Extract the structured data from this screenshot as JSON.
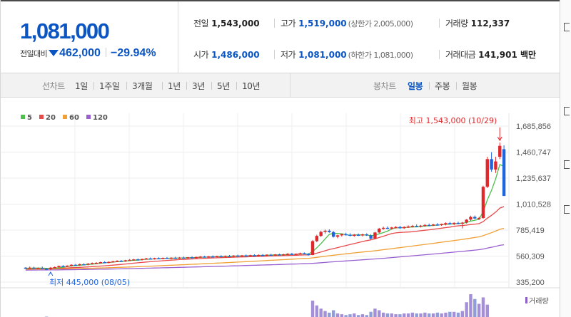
{
  "quote": {
    "price": "1,081,000",
    "change_label": "전일대비",
    "change_amount": "462,000",
    "change_rate": "−29.94%",
    "row1": [
      {
        "label": "전일",
        "value": "1,543,000",
        "blue": false,
        "note": ""
      },
      {
        "label": "고가",
        "value": "1,519,000",
        "blue": true,
        "note": "(상한가 2,005,000)"
      },
      {
        "label": "거래량",
        "value": "112,337",
        "blue": false,
        "note": ""
      }
    ],
    "row2": [
      {
        "label": "시가",
        "value": "1,486,000",
        "blue": true,
        "note": ""
      },
      {
        "label": "저가",
        "value": "1,081,000",
        "blue": true,
        "note": "(하한가 1,081,000)"
      },
      {
        "label": "거래대금",
        "value": "141,901 백만",
        "blue": false,
        "note": ""
      }
    ]
  },
  "toolbar": {
    "line_chart_label": "선차트",
    "periods": [
      "1일",
      "1주일",
      "3개월",
      "1년",
      "3년",
      "5년",
      "10년"
    ],
    "candle_chart_label": "봉차트",
    "candle_periods": [
      "일봉",
      "주봉",
      "월봉"
    ],
    "active_candle_period": "일봉"
  },
  "chart_data": {
    "type": "candlestick",
    "title": "",
    "legend": [
      {
        "name": "5",
        "color": "#4cbf4c"
      },
      {
        "name": "20",
        "color": "#e84a4a"
      },
      {
        "name": "60",
        "color": "#f0a035"
      },
      {
        "name": "120",
        "color": "#9a5fd0"
      }
    ],
    "y_axis": {
      "ticks": [
        "1,685,856",
        "1,460,747",
        "1,235,637",
        "1,010,528",
        "785,419",
        "560,309",
        "335,200"
      ],
      "ylim": [
        335200,
        1685856
      ],
      "position": "right"
    },
    "grid": true,
    "up_color": "#e0272b",
    "down_color": "#1f64dd",
    "annotations": {
      "high": {
        "text": "최고 1,543,000 (10/29)",
        "value": 1543000,
        "date": "10/29"
      },
      "low": {
        "text": "최저 445,000 (08/05)",
        "value": 445000,
        "date": "08/05"
      }
    },
    "volume_label": "거래량",
    "candles": [
      [
        460000,
        465000,
        450000,
        455000
      ],
      [
        455000,
        470000,
        448000,
        460000
      ],
      [
        460000,
        468000,
        452000,
        455000
      ],
      [
        455000,
        462000,
        450000,
        458000
      ],
      [
        458000,
        470000,
        452000,
        452000
      ],
      [
        450000,
        458000,
        445000,
        448000
      ],
      [
        448000,
        465000,
        440000,
        460000
      ],
      [
        460000,
        470000,
        455000,
        465000
      ],
      [
        465000,
        478000,
        460000,
        475000
      ],
      [
        475000,
        482000,
        468000,
        472000
      ],
      [
        472000,
        480000,
        465000,
        478000
      ],
      [
        478000,
        490000,
        470000,
        485000
      ],
      [
        485000,
        492000,
        478000,
        482000
      ],
      [
        482000,
        495000,
        476000,
        490000
      ],
      [
        490000,
        498000,
        484000,
        486000
      ],
      [
        486000,
        500000,
        480000,
        495000
      ],
      [
        495000,
        505000,
        488000,
        500000
      ],
      [
        500000,
        508000,
        494000,
        502000
      ],
      [
        502000,
        512000,
        496000,
        508000
      ],
      [
        508000,
        516000,
        500000,
        504000
      ],
      [
        504000,
        514000,
        498000,
        510000
      ],
      [
        510000,
        520000,
        505000,
        515000
      ],
      [
        515000,
        524000,
        508000,
        520000
      ],
      [
        520000,
        526000,
        512000,
        516000
      ],
      [
        516000,
        528000,
        510000,
        524000
      ],
      [
        524000,
        534000,
        518000,
        528000
      ],
      [
        528000,
        536000,
        520000,
        532000
      ],
      [
        532000,
        540000,
        525000,
        527000
      ],
      [
        527000,
        538000,
        522000,
        535000
      ],
      [
        535000,
        545000,
        530000,
        540000
      ],
      [
        540000,
        548000,
        532000,
        536000
      ],
      [
        536000,
        546000,
        530000,
        542000
      ],
      [
        542000,
        550000,
        536000,
        538000
      ],
      [
        538000,
        548000,
        532000,
        545000
      ],
      [
        545000,
        552000,
        538000,
        540000
      ],
      [
        540000,
        550000,
        534000,
        546000
      ],
      [
        546000,
        554000,
        540000,
        542000
      ],
      [
        542000,
        552000,
        536000,
        548000
      ],
      [
        548000,
        556000,
        540000,
        544000
      ],
      [
        544000,
        552000,
        538000,
        550000
      ],
      [
        550000,
        558000,
        544000,
        546000
      ],
      [
        546000,
        556000,
        540000,
        552000
      ],
      [
        552000,
        560000,
        546000,
        556000
      ],
      [
        556000,
        562000,
        548000,
        550000
      ],
      [
        550000,
        560000,
        544000,
        558000
      ],
      [
        558000,
        566000,
        550000,
        554000
      ],
      [
        554000,
        564000,
        548000,
        560000
      ],
      [
        560000,
        568000,
        552000,
        556000
      ],
      [
        556000,
        566000,
        548000,
        562000
      ],
      [
        562000,
        570000,
        555000,
        558000
      ],
      [
        558000,
        568000,
        552000,
        565000
      ],
      [
        565000,
        572000,
        558000,
        560000
      ],
      [
        560000,
        570000,
        554000,
        566000
      ],
      [
        566000,
        574000,
        560000,
        562000
      ],
      [
        562000,
        572000,
        556000,
        568000
      ],
      [
        568000,
        576000,
        560000,
        565000
      ],
      [
        565000,
        575000,
        558000,
        570000
      ],
      [
        570000,
        578000,
        562000,
        566000
      ],
      [
        566000,
        576000,
        560000,
        572000
      ],
      [
        572000,
        580000,
        565000,
        568000
      ],
      [
        568000,
        578000,
        562000,
        575000
      ],
      [
        575000,
        582000,
        568000,
        570000
      ],
      [
        570000,
        580000,
        564000,
        576000
      ],
      [
        576000,
        586000,
        570000,
        580000
      ],
      [
        580000,
        588000,
        570000,
        574000
      ],
      [
        574000,
        584000,
        566000,
        580000
      ],
      [
        580000,
        590000,
        574000,
        585000
      ],
      [
        585000,
        592000,
        576000,
        578000
      ],
      [
        578000,
        586000,
        565000,
        570000
      ],
      [
        570000,
        700000,
        568000,
        690000
      ],
      [
        690000,
        745000,
        680000,
        735000
      ],
      [
        735000,
        780000,
        725000,
        770000
      ],
      [
        770000,
        790000,
        755000,
        780000
      ],
      [
        780000,
        792000,
        762000,
        768000
      ],
      [
        768000,
        778000,
        720000,
        728000
      ],
      [
        728000,
        745000,
        715000,
        740000
      ],
      [
        740000,
        756000,
        730000,
        750000
      ],
      [
        750000,
        762000,
        738000,
        745000
      ],
      [
        745000,
        758000,
        732000,
        738000
      ],
      [
        738000,
        752000,
        728000,
        745000
      ],
      [
        745000,
        756000,
        734000,
        742000
      ],
      [
        742000,
        755000,
        730000,
        748000
      ],
      [
        748000,
        758000,
        735000,
        740000
      ],
      [
        740000,
        750000,
        702000,
        712000
      ],
      [
        712000,
        770000,
        706000,
        765000
      ],
      [
        765000,
        805000,
        758000,
        798000
      ],
      [
        798000,
        815000,
        788000,
        805000
      ],
      [
        805000,
        818000,
        794000,
        800000
      ],
      [
        800000,
        812000,
        790000,
        808000
      ],
      [
        808000,
        820000,
        800000,
        812000
      ],
      [
        812000,
        822000,
        796000,
        802000
      ],
      [
        802000,
        818000,
        796000,
        812000
      ],
      [
        812000,
        826000,
        804000,
        816000
      ],
      [
        816000,
        830000,
        808000,
        822000
      ],
      [
        822000,
        834000,
        810000,
        814000
      ],
      [
        814000,
        830000,
        808000,
        824000
      ],
      [
        824000,
        838000,
        814000,
        830000
      ],
      [
        830000,
        842000,
        818000,
        826000
      ],
      [
        826000,
        840000,
        820000,
        834000
      ],
      [
        834000,
        846000,
        824000,
        830000
      ],
      [
        830000,
        842000,
        822000,
        838000
      ],
      [
        838000,
        852000,
        826000,
        846000
      ],
      [
        846000,
        856000,
        832000,
        838000
      ],
      [
        838000,
        852000,
        828000,
        848000
      ],
      [
        848000,
        858000,
        836000,
        842000
      ],
      [
        842000,
        856000,
        800000,
        850000
      ],
      [
        850000,
        880000,
        842000,
        876000
      ],
      [
        876000,
        910000,
        866000,
        900000
      ],
      [
        900000,
        912000,
        878000,
        886000
      ],
      [
        886000,
        900000,
        872000,
        890000
      ],
      [
        890000,
        1170000,
        884000,
        1160000
      ],
      [
        1160000,
        1420000,
        1150000,
        1400000
      ],
      [
        1400000,
        1460000,
        1290000,
        1310000
      ],
      [
        1310000,
        1420000,
        1280000,
        1380000
      ],
      [
        1420000,
        1543000,
        1400000,
        1515000
      ],
      [
        1486000,
        1519000,
        1081000,
        1081000
      ]
    ],
    "volumes": [
      3,
      2,
      3,
      2,
      2,
      4,
      3,
      2,
      3,
      2,
      2,
      3,
      2,
      2,
      3,
      2,
      2,
      3,
      2,
      2,
      2,
      3,
      2,
      2,
      3,
      2,
      2,
      3,
      2,
      2,
      2,
      3,
      2,
      2,
      2,
      3,
      2,
      2,
      2,
      3,
      2,
      2,
      2,
      3,
      2,
      2,
      2,
      3,
      2,
      2,
      2,
      2,
      3,
      2,
      2,
      2,
      2,
      3,
      2,
      2,
      2,
      2,
      3,
      2,
      2,
      2,
      3,
      2,
      2,
      24,
      18,
      14,
      11,
      9,
      12,
      8,
      7,
      6,
      7,
      8,
      6,
      7,
      6,
      10,
      14,
      12,
      9,
      8,
      8,
      7,
      7,
      8,
      8,
      9,
      8,
      8,
      9,
      8,
      8,
      9,
      8,
      9,
      10,
      10,
      9,
      11,
      22,
      32,
      26,
      20,
      28,
      19
    ]
  }
}
